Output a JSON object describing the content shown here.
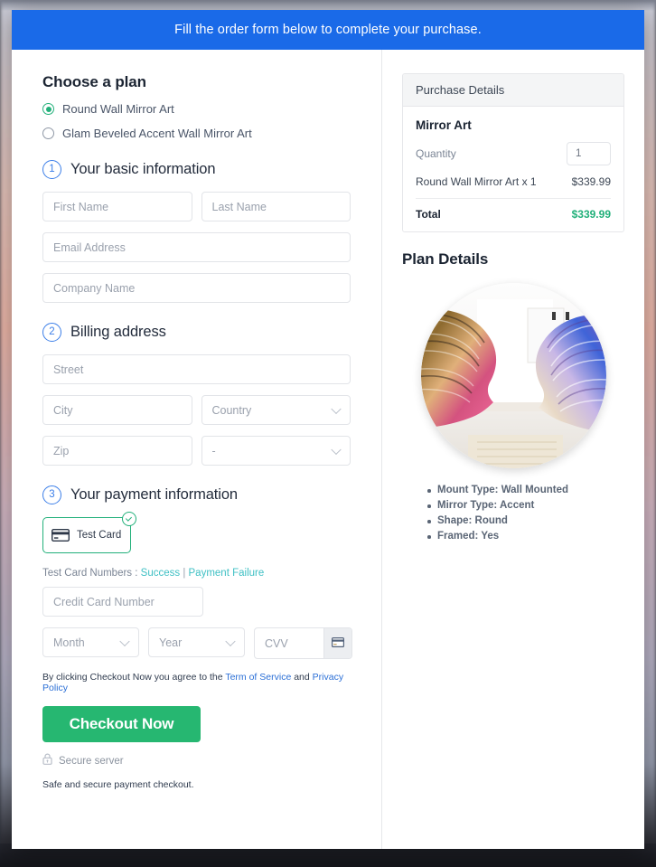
{
  "banner": {
    "text": "Fill the order form below to complete your purchase."
  },
  "plan": {
    "heading": "Choose a plan",
    "options": [
      {
        "label": "Round Wall Mirror Art",
        "selected": true
      },
      {
        "label": "Glam Beveled Accent Wall Mirror Art",
        "selected": false
      }
    ]
  },
  "step1": {
    "number": "1",
    "title": "Your basic information",
    "first_name_placeholder": "First Name",
    "last_name_placeholder": "Last Name",
    "email_placeholder": "Email Address",
    "company_placeholder": "Company Name"
  },
  "step2": {
    "number": "2",
    "title": "Billing address",
    "street_placeholder": "Street",
    "city_placeholder": "City",
    "country_placeholder": "Country",
    "zip_placeholder": "Zip",
    "state_placeholder": "-"
  },
  "step3": {
    "number": "3",
    "title": "Your payment information",
    "card_tile_label": "Test  Card",
    "test_numbers_label": "Test Card Numbers : ",
    "link_success": "Success",
    "link_separator": " | ",
    "link_failure": "Payment Failure",
    "credit_card_placeholder": "Credit Card Number",
    "month_placeholder": "Month",
    "year_placeholder": "Year",
    "cvv_placeholder": "CVV"
  },
  "footer": {
    "terms_prefix": "By clicking Checkout Now you agree to the ",
    "terms_link": "Term of Service",
    "terms_middle": " and ",
    "privacy_link": "Privacy Policy",
    "checkout_label": "Checkout Now",
    "secure_label": "Secure server",
    "safe_label": "Safe and secure payment checkout."
  },
  "purchase": {
    "header": "Purchase Details",
    "product": "Mirror Art",
    "quantity_label": "Quantity",
    "quantity_value": "1",
    "line_item_label": "Round Wall Mirror Art x 1",
    "line_item_price": "$339.99",
    "total_label": "Total",
    "total_price": "$339.99"
  },
  "plan_details": {
    "heading": "Plan Details",
    "features": [
      "Mount Type: Wall Mounted",
      "Mirror Type: Accent",
      "Shape: Round",
      "Framed: Yes"
    ]
  },
  "colors": {
    "banner_blue": "#1a6ae8",
    "accent_green": "#22b07a",
    "checkout_green": "#26b771",
    "link_teal": "#3fc0c4",
    "link_blue": "#2b6fd6",
    "step_blue": "#3b7ee8"
  }
}
